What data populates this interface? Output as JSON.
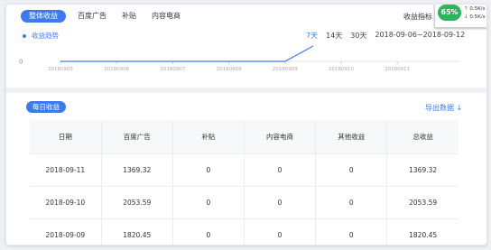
{
  "tabs": [
    {
      "label": "整体收益",
      "active": true
    },
    {
      "label": "百度广告",
      "active": false
    },
    {
      "label": "补贴",
      "active": false
    },
    {
      "label": "内容电商",
      "active": false
    }
  ],
  "metric_label": "收益指标",
  "net_widget": {
    "percent": "65%",
    "up_speed": "0.5K/s",
    "down_speed": "0.5K/s",
    "up_arrow": "↑",
    "down_arrow": "↓"
  },
  "trend_title": "收益趋势",
  "ranges": {
    "days7": "7天",
    "days14": "14天",
    "days30": "30天",
    "date_range": "2018-09-06~2018-09-12"
  },
  "chart_data": {
    "type": "line",
    "x": [
      "20180905",
      "20180906",
      "20180907",
      "20180908",
      "20180909",
      "20180910",
      "20180911"
    ],
    "y_axis_label": "0",
    "series": [
      {
        "points": [
          {
            "date": "20180905",
            "value": 0
          },
          {
            "date": "20180906",
            "value": 0
          },
          {
            "date": "20180907",
            "value": 0
          },
          {
            "date": "20180908",
            "value": 0
          },
          {
            "date": "20180909",
            "value": 0
          },
          {
            "date": "20180909.5",
            "value": 1820.45
          }
        ]
      }
    ],
    "ylim": [
      0,
      1820.45
    ],
    "line_color": "#3d7bed"
  },
  "daily": {
    "title": "每日收益",
    "export_label": "导出数据 ↓",
    "columns": [
      "日期",
      "百度广告",
      "补贴",
      "内容电商",
      "其他收益",
      "总收益"
    ],
    "rows": [
      [
        "2018-09-11",
        "1369.32",
        "0",
        "0",
        "0",
        "1369.32"
      ],
      [
        "2018-09-10",
        "2053.59",
        "0",
        "0",
        "0",
        "2053.59"
      ],
      [
        "2018-09-09",
        "1820.45",
        "0",
        "0",
        "0",
        "1820.45"
      ]
    ]
  },
  "colors": {
    "accent": "#3d7bed",
    "widget_green": "#2fb35d"
  }
}
